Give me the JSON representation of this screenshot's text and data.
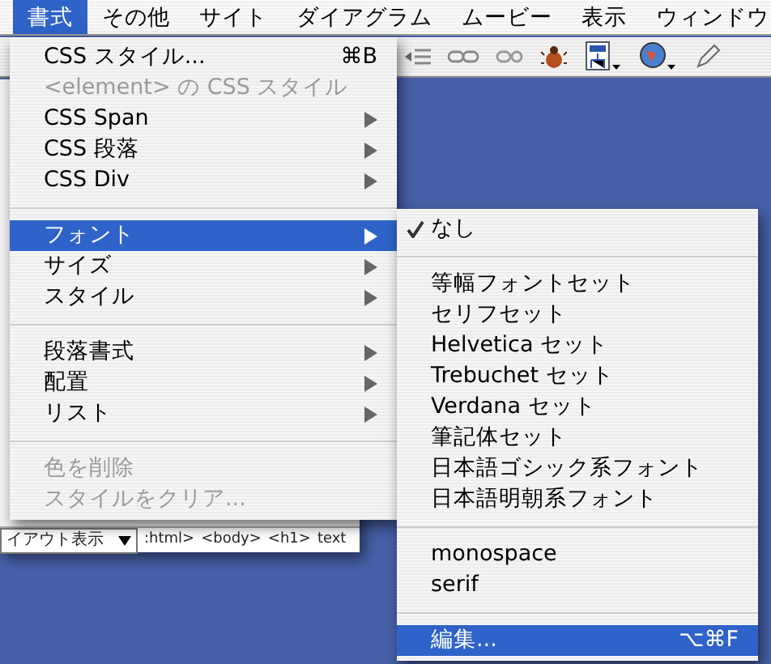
{
  "menubar": [
    {
      "label": "書式",
      "selected": true
    },
    {
      "label": "その他",
      "selected": false
    },
    {
      "label": "サイト",
      "selected": false
    },
    {
      "label": "ダイアグラム",
      "selected": false
    },
    {
      "label": "ムービー",
      "selected": false
    },
    {
      "label": "表示",
      "selected": false
    },
    {
      "label": "ウィンドウ",
      "selected": false
    }
  ],
  "menu": {
    "items": [
      {
        "kind": "item",
        "label": "CSS スタイル...",
        "shortcut": "⌘B",
        "disabled": false,
        "submenu": false,
        "selected": false
      },
      {
        "kind": "item",
        "label": "<element> の CSS スタイル",
        "disabled": true,
        "submenu": false,
        "selected": false
      },
      {
        "kind": "item",
        "label": "CSS Span",
        "disabled": false,
        "submenu": true,
        "selected": false
      },
      {
        "kind": "item",
        "label": "CSS 段落",
        "disabled": false,
        "submenu": true,
        "selected": false
      },
      {
        "kind": "item",
        "label": "CSS Div",
        "disabled": false,
        "submenu": true,
        "selected": false
      },
      {
        "kind": "separator"
      },
      {
        "kind": "item",
        "label": "フォント",
        "disabled": false,
        "submenu": true,
        "selected": true
      },
      {
        "kind": "item",
        "label": "サイズ",
        "disabled": false,
        "submenu": true,
        "selected": false
      },
      {
        "kind": "item",
        "label": "スタイル",
        "disabled": false,
        "submenu": true,
        "selected": false
      },
      {
        "kind": "separator"
      },
      {
        "kind": "item",
        "label": "段落書式",
        "disabled": false,
        "submenu": true,
        "selected": false
      },
      {
        "kind": "item",
        "label": "配置",
        "disabled": false,
        "submenu": true,
        "selected": false
      },
      {
        "kind": "item",
        "label": "リスト",
        "disabled": false,
        "submenu": true,
        "selected": false
      },
      {
        "kind": "separator"
      },
      {
        "kind": "item",
        "label": "色を削除",
        "disabled": true,
        "submenu": false,
        "selected": false
      },
      {
        "kind": "item",
        "label": "スタイルをクリア...",
        "disabled": true,
        "submenu": false,
        "selected": false
      }
    ]
  },
  "submenu": {
    "items": [
      {
        "kind": "item",
        "label": "なし",
        "checked": true,
        "selected": false
      },
      {
        "kind": "separator"
      },
      {
        "kind": "item",
        "label": "等幅フォントセット",
        "checked": false,
        "selected": false
      },
      {
        "kind": "item",
        "label": "セリフセット",
        "checked": false,
        "selected": false
      },
      {
        "kind": "item",
        "label": "Helvetica セット",
        "checked": false,
        "selected": false
      },
      {
        "kind": "item",
        "label": "Trebuchet セット",
        "checked": false,
        "selected": false
      },
      {
        "kind": "item",
        "label": "Verdana セット",
        "checked": false,
        "selected": false
      },
      {
        "kind": "item",
        "label": "筆記体セット",
        "checked": false,
        "selected": false
      },
      {
        "kind": "item",
        "label": "日本語ゴシック系フォント",
        "checked": false,
        "selected": false
      },
      {
        "kind": "item",
        "label": "日本語明朝系フォント",
        "checked": false,
        "selected": false
      },
      {
        "kind": "separator"
      },
      {
        "kind": "item",
        "label": "monospace",
        "checked": false,
        "selected": false
      },
      {
        "kind": "item",
        "label": "serif",
        "checked": false,
        "selected": false
      },
      {
        "kind": "separator"
      },
      {
        "kind": "item",
        "label": "編集...",
        "shortcut": "⌥⌘F",
        "checked": false,
        "selected": true
      }
    ]
  },
  "status_bar": {
    "view": "イアウト表示",
    "path": [
      ":html>",
      "<body>",
      "<h1>",
      "text"
    ]
  }
}
